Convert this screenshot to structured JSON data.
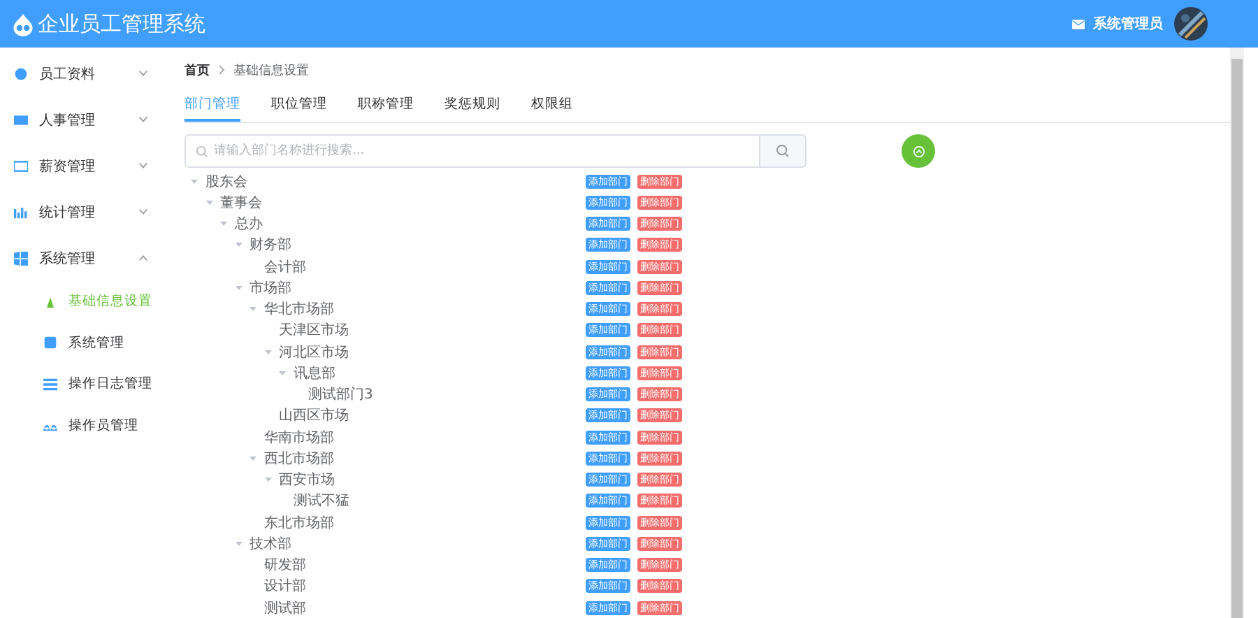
{
  "header": {
    "title": "企业员工管理系统",
    "user": "系统管理员"
  },
  "sidebar": {
    "items": [
      {
        "label": "员工资料",
        "expanded": false
      },
      {
        "label": "人事管理",
        "expanded": false
      },
      {
        "label": "薪资管理",
        "expanded": false
      },
      {
        "label": "统计管理",
        "expanded": false
      },
      {
        "label": "系统管理",
        "expanded": true,
        "children": [
          {
            "label": "基础信息设置",
            "selected": true
          },
          {
            "label": "系统管理",
            "selected": false
          },
          {
            "label": "操作日志管理",
            "selected": false
          },
          {
            "label": "操作员管理",
            "selected": false
          }
        ]
      }
    ]
  },
  "breadcrumb": [
    "首页",
    "基础信息设置"
  ],
  "tabs": [
    {
      "label": "部门管理",
      "selected": true
    },
    {
      "label": "职位管理",
      "selected": false
    },
    {
      "label": "职称管理",
      "selected": false
    },
    {
      "label": "奖惩规则",
      "selected": false
    },
    {
      "label": "权限组",
      "selected": false
    }
  ],
  "search": {
    "placeholder": "请输入部门名称进行搜索..."
  },
  "tree": [
    {
      "label": "股东会",
      "expanded": true,
      "add": "添加部门",
      "del": "删除部门",
      "children": [
        {
          "label": "董事会",
          "expanded": true,
          "add": "添加部门",
          "del": "删除部门",
          "children": [
            {
              "label": "总办",
              "expanded": true,
              "add": "添加部门",
              "del": "删除部门",
              "children": [
                {
                  "label": "财务部",
                  "expanded": true,
                  "add": "添加部门",
                  "del": "删除部门",
                  "children": [
                    {
                      "label": "会计部",
                      "add": "添加部门",
                      "del": "删除部门"
                    }
                  ]
                },
                {
                  "label": "市场部",
                  "expanded": true,
                  "add": "添加部门",
                  "del": "删除部门",
                  "children": [
                    {
                      "label": "华北市场部",
                      "expanded": true,
                      "add": "添加部门",
                      "del": "删除部门",
                      "children": [
                        {
                          "label": "天津区市场",
                          "add": "添加部门",
                          "del": "删除部门"
                        },
                        {
                          "label": "河北区市场",
                          "expanded": true,
                          "add": "添加部门",
                          "del": "删除部门",
                          "children": [
                            {
                              "label": "讯息部",
                              "expanded": true,
                              "add": "添加部门",
                              "del": "删除部门",
                              "children": [
                                {
                                  "label": "测试部门3",
                                  "add": "添加部门",
                                  "del": "删除部门"
                                }
                              ]
                            }
                          ]
                        },
                        {
                          "label": "山西区市场",
                          "add": "添加部门",
                          "del": "删除部门"
                        }
                      ]
                    },
                    {
                      "label": "华南市场部",
                      "add": "添加部门",
                      "del": "删除部门"
                    },
                    {
                      "label": "西北市场部",
                      "expanded": true,
                      "add": "添加部门",
                      "del": "删除部门",
                      "children": [
                        {
                          "label": "西安市场",
                          "expanded": true,
                          "add": "添加部门",
                          "del": "删除部门",
                          "children": [
                            {
                              "label": "测试不猛",
                              "add": "添加部门",
                              "del": "删除部门"
                            }
                          ]
                        }
                      ]
                    },
                    {
                      "label": "东北市场部",
                      "add": "添加部门",
                      "del": "删除部门"
                    }
                  ]
                },
                {
                  "label": "技术部",
                  "expanded": true,
                  "add": "添加部门",
                  "del": "删除部门",
                  "children": [
                    {
                      "label": "研发部",
                      "add": "添加部门",
                      "del": "删除部门"
                    },
                    {
                      "label": "设计部",
                      "add": "添加部门",
                      "del": "删除部门"
                    },
                    {
                      "label": "测试部",
                      "add": "添加部门",
                      "del": "删除部门"
                    }
                  ]
                }
              ]
            }
          ]
        }
      ]
    }
  ]
}
